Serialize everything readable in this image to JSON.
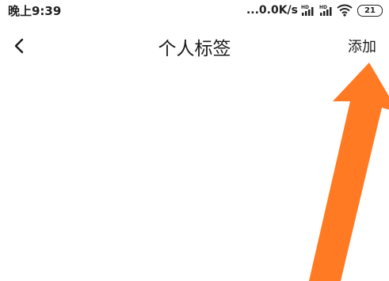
{
  "status_bar": {
    "time": "晚上9:39",
    "network_speed": "...0.0K/s",
    "battery_level": "21",
    "icons": [
      "hd-signal-icon",
      "hd-signal-icon",
      "wifi-icon",
      "battery-icon"
    ]
  },
  "nav": {
    "back_icon": "chevron-left-icon",
    "title": "个人标签",
    "action_label": "添加"
  },
  "annotation": {
    "arrow_color": "#ff7a22"
  }
}
